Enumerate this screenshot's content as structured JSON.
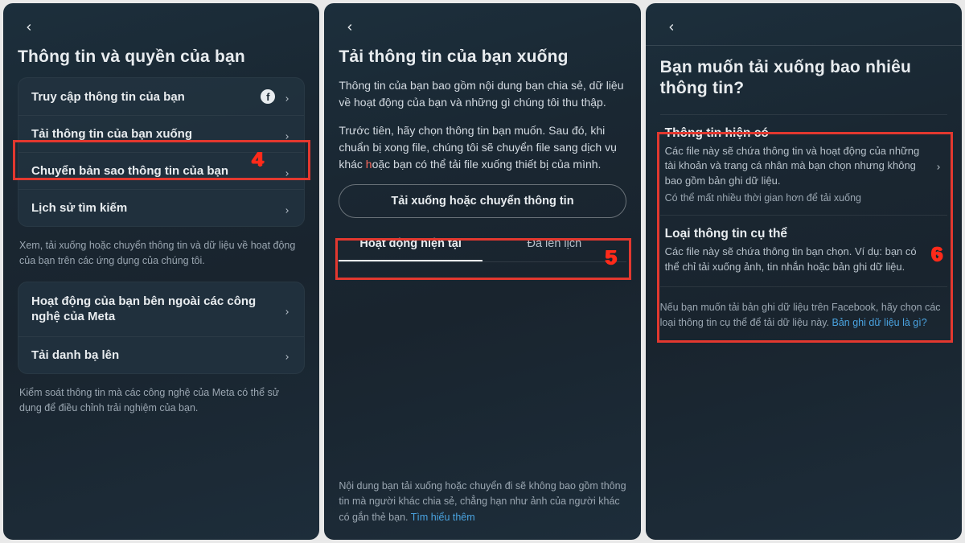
{
  "s1": {
    "title": "Thông tin và quyền của bạn",
    "rows_g1": [
      "Truy cập thông tin của bạn",
      "Tải thông tin của bạn xuống",
      "Chuyển bản sao thông tin của bạn",
      "Lịch sử tìm kiếm"
    ],
    "note1": "Xem, tải xuống hoặc chuyển thông tin và dữ liệu về hoạt động của bạn trên các ứng dụng của chúng tôi.",
    "rows_g2": [
      "Hoạt động của bạn bên ngoài các công nghệ của Meta",
      "Tải danh bạ lên"
    ],
    "note2": "Kiểm soát thông tin mà các công nghệ của Meta có thể sử dụng để điều chỉnh trải nghiệm của bạn.",
    "step": "4"
  },
  "s2": {
    "title": "Tải thông tin của bạn xuống",
    "p1": "Thông tin của bạn bao gồm nội dung bạn chia sẻ, dữ liệu về hoạt động của bạn và những gì chúng tôi thu thập.",
    "p2a": "Trước tiên, hãy chọn thông tin bạn muốn. Sau đó, khi chuẩn bị xong file, chúng tôi sẽ chuyển file sang dịch vụ khác ",
    "p2h": "h",
    "p2b": "oặc bạn có thể tải file xuống thiết bị của mình.",
    "btn": "Tải xuống hoặc chuyển thông tin",
    "tab_active": "Hoạt động hiện tại",
    "tab_other": "Đã lên lịch",
    "foot_a": "Nội dung bạn tải xuống hoặc chuyển đi sẽ không bao gồm thông tin mà người khác chia sẻ, chẳng hạn như ảnh của người khác có gắn thẻ bạn. ",
    "foot_link": "Tìm hiểu thêm",
    "step": "5"
  },
  "s3": {
    "title": "Bạn muốn tải xuống bao nhiêu thông tin?",
    "opt1_title": "Thông tin hiện có",
    "opt1_desc": "Các file này sẽ chứa thông tin và hoạt động của những tài khoản và trang cá nhân mà bạn chọn nhưng không bao gồm bản ghi dữ liệu.",
    "opt1_sub": "Có thể mất nhiều thời gian hơn để tải xuống",
    "opt2_title": "Loại thông tin cụ thể",
    "opt2_desc": "Các file này sẽ chứa thông tin bạn chọn. Ví dụ: bạn có thể chỉ tải xuống ảnh, tin nhắn hoặc bản ghi dữ liệu.",
    "foot_a": "Nếu bạn muốn tải bản ghi dữ liệu trên Facebook, hãy chọn các loại thông tin cụ thể để tải dữ liệu này. ",
    "foot_link": "Bản ghi dữ liệu là gì?",
    "step": "6"
  }
}
